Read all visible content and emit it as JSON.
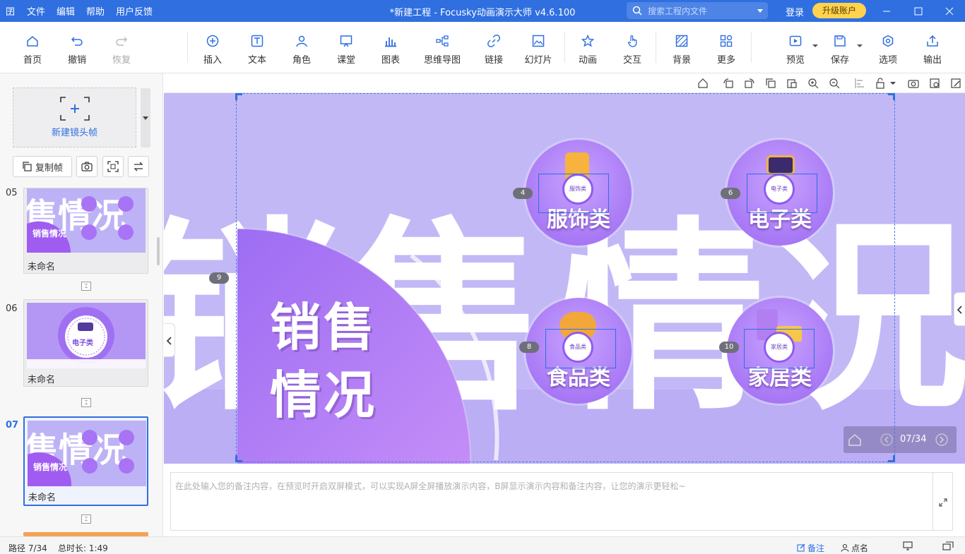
{
  "titlebar": {
    "app_icon": "囝",
    "menu": [
      "文件",
      "编辑",
      "帮助",
      "用户反馈"
    ],
    "title": "*新建工程 - Focusky动画演示大师  v4.6.100",
    "search_placeholder": "搜索工程内文件",
    "login": "登录",
    "upgrade": "升级账户"
  },
  "toolbar": {
    "home": "首页",
    "undo": "撤销",
    "redo": "恢复",
    "insert": "插入",
    "text": "文本",
    "role": "角色",
    "classroom": "课堂",
    "chart": "图表",
    "mindmap": "思维导图",
    "link": "链接",
    "slideshow": "幻灯片",
    "animation": "动画",
    "interaction": "交互",
    "background": "背景",
    "more": "更多",
    "preview": "预览",
    "save": "保存",
    "options": "选项",
    "export": "输出"
  },
  "sidebar": {
    "new_frame": "新建镜头帧",
    "copy_frame": "复制帧",
    "thumbs": [
      {
        "num": "05",
        "label": "未命名"
      },
      {
        "num": "06",
        "label": "未命名"
      },
      {
        "num": "07",
        "label": "未命名"
      }
    ],
    "thumb_texts": {
      "t05_title": "销售情况",
      "t06_badge": "电子类",
      "t07_title": "销售情况"
    }
  },
  "slide": {
    "bg_text_1": "销售",
    "bg_text_2": "情况",
    "title_line1": "销售",
    "title_line2": "情况",
    "categories": [
      {
        "tag": "4",
        "caption": "服饰类",
        "badge": "服饰类"
      },
      {
        "tag": "6",
        "caption": "电子类",
        "badge": "电子类"
      },
      {
        "tag": "8",
        "caption": "食品类",
        "badge": "食品类"
      },
      {
        "tag": "10",
        "caption": "家居类",
        "badge": "家居类"
      }
    ],
    "frame_tag": "9",
    "page_indicator": "07/34"
  },
  "notes": {
    "placeholder": "在此处输入您的备注内容，在预览时开启双屏模式，可以实现A屏全屏播放演示内容，B屏显示演示内容和备注内容，让您的演示更轻松~"
  },
  "status": {
    "path": "路径 7/34",
    "duration": "总时长: 1:49",
    "notes": "备注",
    "rollcall": "点名"
  },
  "colors": {
    "accent": "#2f6fe0",
    "slide_bg": "#c2b7f6",
    "purple": "#9b67f1",
    "upgrade": "#ffd34d"
  }
}
